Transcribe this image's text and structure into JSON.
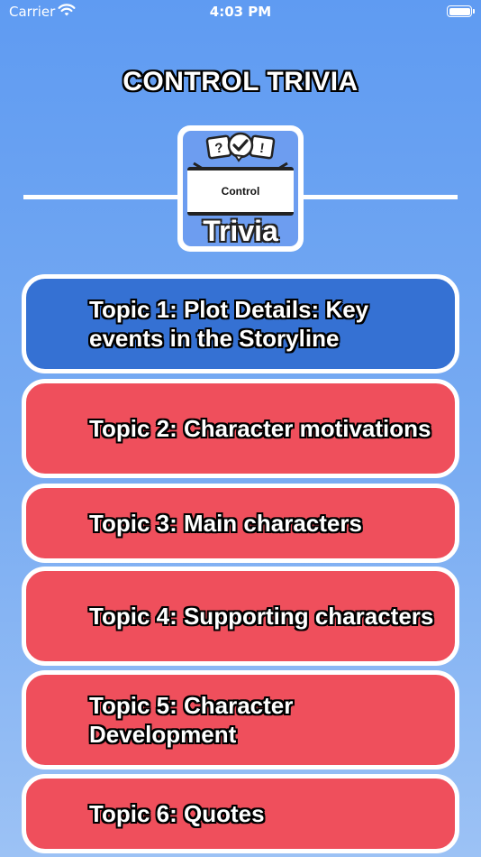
{
  "status_bar": {
    "carrier": "Carrier",
    "time": "4:03 PM",
    "wifi_icon": "wifi-icon",
    "battery_icon": "battery-icon",
    "battery_level": 1.0
  },
  "header": {
    "title": "CONTROL TRIVIA"
  },
  "logo": {
    "board_text": "Control",
    "word": "Trivia",
    "bubble_glyphs": [
      "?",
      "✓",
      "!"
    ]
  },
  "topics": [
    {
      "label": "Topic 1: Plot Details: Key events in the Storyline",
      "selected": true
    },
    {
      "label": "Topic 2: Character motivations",
      "selected": false
    },
    {
      "label": "Topic 3: Main characters",
      "selected": false
    },
    {
      "label": "Topic 4: Supporting characters",
      "selected": false
    },
    {
      "label": "Topic 5: Character Development",
      "selected": false
    },
    {
      "label": "Topic 6: Quotes",
      "selected": false
    }
  ],
  "colors": {
    "background_top": "#5f9bf2",
    "background_bottom": "#9cc2f5",
    "topic_default": "#ef4f5c",
    "topic_selected": "#3571d3",
    "outline": "#ffffff"
  }
}
